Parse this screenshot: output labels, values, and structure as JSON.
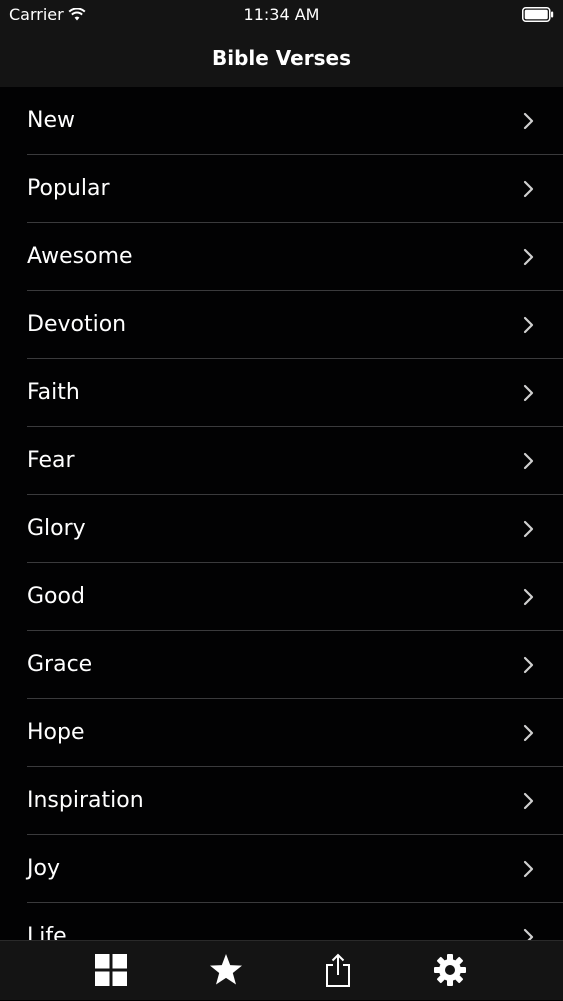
{
  "status_bar": {
    "carrier": "Carrier",
    "time": "11:34 AM"
  },
  "nav": {
    "title": "Bible Verses"
  },
  "list": {
    "items": [
      {
        "label": "New"
      },
      {
        "label": "Popular"
      },
      {
        "label": "Awesome"
      },
      {
        "label": "Devotion"
      },
      {
        "label": "Faith"
      },
      {
        "label": "Fear"
      },
      {
        "label": "Glory"
      },
      {
        "label": "Good"
      },
      {
        "label": "Grace"
      },
      {
        "label": "Hope"
      },
      {
        "label": "Inspiration"
      },
      {
        "label": "Joy"
      },
      {
        "label": "Life"
      }
    ]
  },
  "tab_bar": {
    "tabs": [
      {
        "icon": "grid-icon"
      },
      {
        "icon": "star-icon"
      },
      {
        "icon": "share-icon"
      },
      {
        "icon": "gear-icon"
      }
    ]
  },
  "colors": {
    "background": "#020203",
    "bars": "#141414",
    "separator": "#3a3a3c",
    "text": "#ffffff",
    "chevron": "#cfcfcf"
  }
}
